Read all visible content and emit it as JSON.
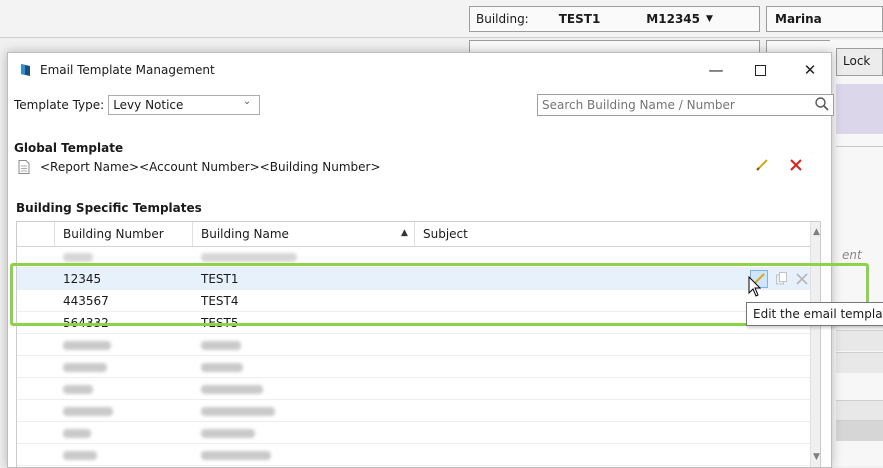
{
  "background_app": {
    "building_label": "Building:",
    "building_name": "TEST1",
    "building_number": "M12345",
    "user": "Marina",
    "lock_label": "Lock",
    "partial_text": "ent",
    "accent_color": "#dcd6ea"
  },
  "dialog": {
    "title": "Email Template Management",
    "template_type_label": "Template Type:",
    "template_type_value": "Levy Notice",
    "search_placeholder": "Search Building Name / Number",
    "global_section_title": "Global Template",
    "global_template_subject": "<Report Name><Account Number><Building Number>",
    "building_section_title": "Building Specific Templates",
    "columns": [
      "Building Number",
      "Building Name",
      "Subject"
    ],
    "rows": [
      {
        "number": "12345",
        "name": "TEST1",
        "subject": ""
      },
      {
        "number": "443567",
        "name": "TEST4",
        "subject": ""
      },
      {
        "number": "564332",
        "name": "TEST5",
        "subject": ""
      }
    ],
    "tooltip": "Edit the email template",
    "icons": {
      "edit": "pencil-icon",
      "delete": "close-icon",
      "copy": "copy-icon",
      "search": "search-icon"
    },
    "colors": {
      "highlight": "#8cd24a",
      "delete": "#e0221c",
      "edit": "#d9a515",
      "selected_row": "#e7f1fb"
    }
  }
}
